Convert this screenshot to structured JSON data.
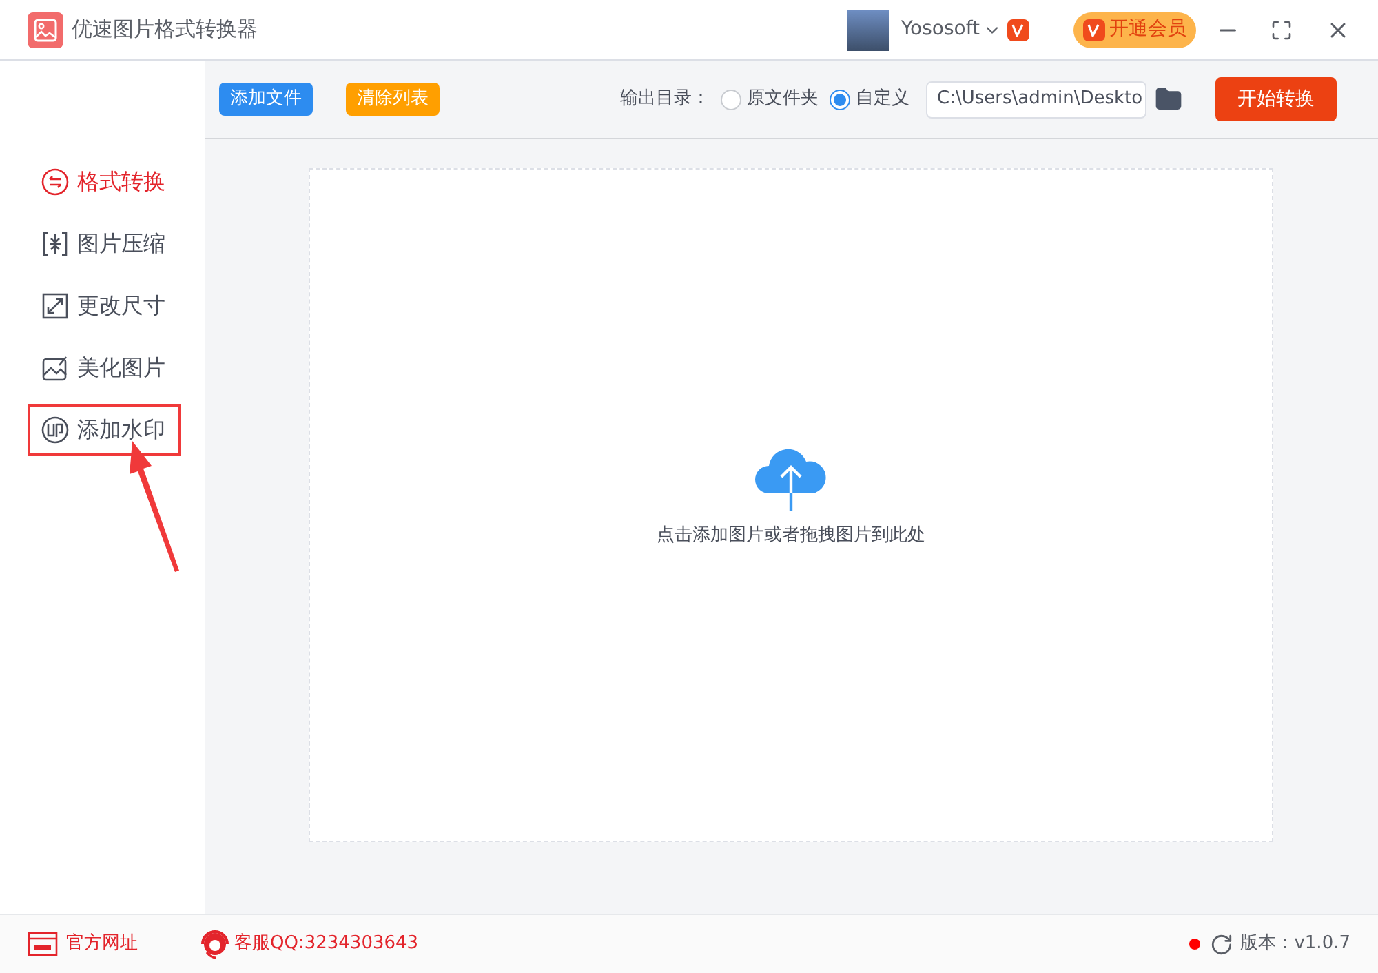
{
  "window": {
    "title": "优速图片格式转换器",
    "user": "Yososoft",
    "vip_button": "开通会员"
  },
  "toolbar": {
    "add_button": "添加文件",
    "clear_button": "清除列表",
    "output_label": "输出目录：",
    "output_options": [
      {
        "label": "原文件夹",
        "selected": false
      },
      {
        "label": "自定义",
        "selected": true
      }
    ],
    "path": "C:\\Users\\admin\\Deskto",
    "start_button": "开始转换"
  },
  "sidebar": {
    "items": [
      {
        "label": "格式转换",
        "selected": true,
        "highlighted": false
      },
      {
        "label": "图片压缩",
        "selected": false,
        "highlighted": false
      },
      {
        "label": "更改尺寸",
        "selected": false,
        "highlighted": false
      },
      {
        "label": "美化图片",
        "selected": false,
        "highlighted": false
      },
      {
        "label": "添加水印",
        "selected": false,
        "highlighted": true
      }
    ]
  },
  "drop_zone": {
    "hint": "点击添加图片或者拖拽图片到此处"
  },
  "status_bar": {
    "website": "官方网址",
    "support": "客服QQ:3234303643",
    "version": "版本：v1.0.7"
  }
}
